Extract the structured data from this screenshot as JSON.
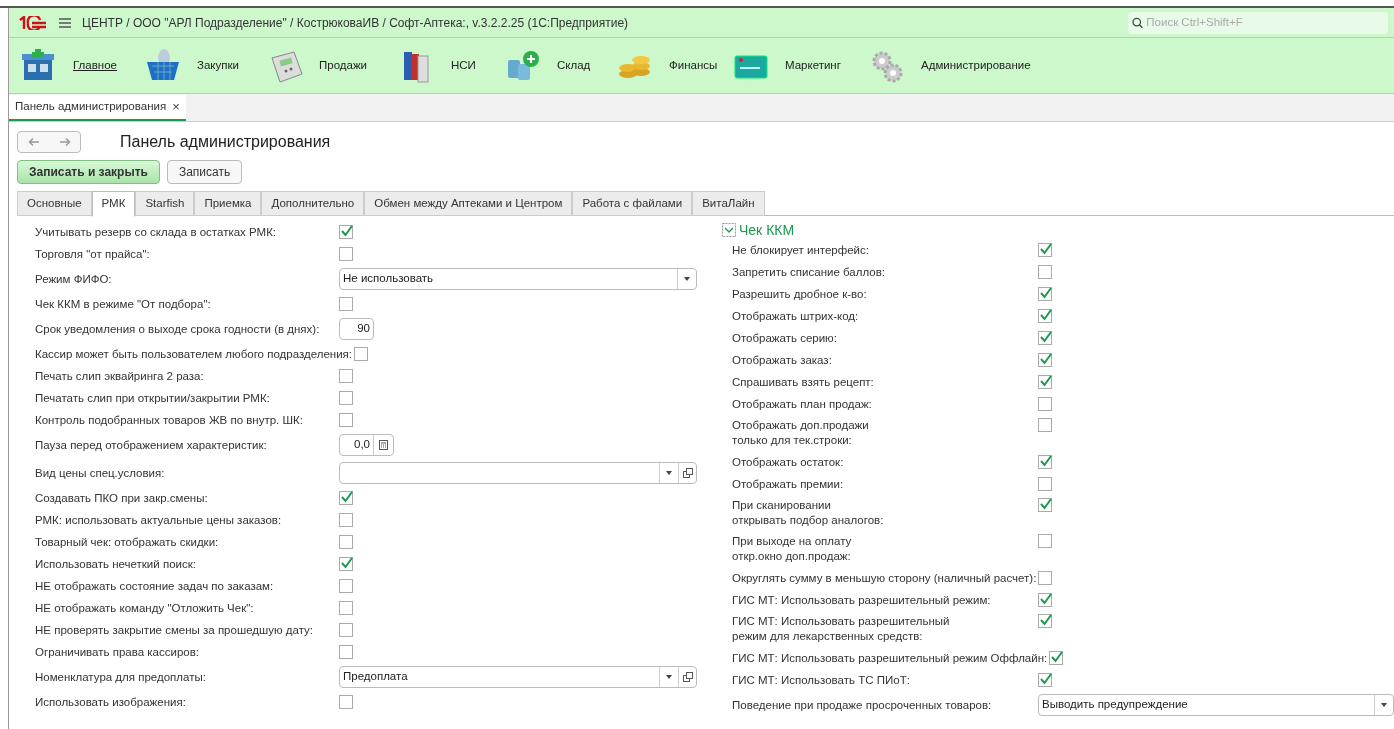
{
  "window": {
    "title": "ЦЕНТР / ООО \"АРЛ Подразделение\" / КострюковаИВ / Софт-Аптека:, v.3.2.2.25  (1С:Предприятие)",
    "search": {
      "placeholder": "Поиск Ctrl+Shift+F"
    }
  },
  "sections": [
    {
      "label": "Главное",
      "kind": "pharmacy",
      "selected": true
    },
    {
      "label": "Закупки",
      "kind": "basket",
      "selected": false
    },
    {
      "label": "Продажи",
      "kind": "terminal",
      "selected": false
    },
    {
      "label": "НСИ",
      "kind": "books",
      "selected": false
    },
    {
      "label": "Склад",
      "kind": "pills",
      "selected": false
    },
    {
      "label": "Финансы",
      "kind": "coins",
      "selected": false
    },
    {
      "label": "Маркетинг",
      "kind": "card",
      "selected": false
    },
    {
      "label": "Администрирование",
      "kind": "gears",
      "selected": false
    }
  ],
  "open_tabs": [
    {
      "label": "Панель администрирования",
      "close": "×",
      "selected": true
    }
  ],
  "form": {
    "title": "Панель администрирования",
    "buttons": [
      {
        "label": "Записать и закрыть",
        "kind": "primary"
      },
      {
        "label": "Записать",
        "kind": "plain"
      }
    ],
    "tabs": [
      {
        "label": "Основные",
        "selected": false
      },
      {
        "label": "РМК",
        "selected": true
      },
      {
        "label": "Starfish",
        "selected": false
      },
      {
        "label": "Приемка",
        "selected": false
      },
      {
        "label": "Дополнительно",
        "selected": false
      },
      {
        "label": "Обмен между Аптеками и Центром",
        "selected": false
      },
      {
        "label": "Работа с файлами",
        "selected": false
      },
      {
        "label": "ВитаЛайн",
        "selected": false
      }
    ],
    "left": [
      {
        "kind": "checkbox",
        "label": "Учитывать резерв со склада в остатках РМК:",
        "checked": true
      },
      {
        "kind": "checkbox",
        "label": "Торговля \"от прайса\":",
        "checked": false
      },
      {
        "kind": "select",
        "label": "Режим ФИФО:",
        "value": "Не использовать"
      },
      {
        "kind": "checkbox",
        "label": "Чек ККМ в режиме \"От подбора\":",
        "checked": false
      },
      {
        "kind": "number",
        "label": "Срок уведомления о выходе срока годности (в днях):",
        "value": "90"
      },
      {
        "kind": "checkbox",
        "label": "Кассир может быть пользователем любого подразделения:",
        "checked": false
      },
      {
        "kind": "checkbox",
        "label": "Печать слип эквайринга 2 раза:",
        "checked": false
      },
      {
        "kind": "checkbox",
        "label": "Печатать слип при открытии/закрытии РМК:",
        "checked": false
      },
      {
        "kind": "checkbox",
        "label": "Контроль подобранных товаров ЖВ по внутр. ШК:",
        "checked": false
      },
      {
        "kind": "calc",
        "label": "Пауза перед отображением характеристик:",
        "value": "0,0"
      },
      {
        "kind": "ref",
        "label": "Вид цены спец.условия:"
      },
      {
        "kind": "checkbox",
        "label": "Создавать ПКО при закр.смены:",
        "checked": true
      },
      {
        "kind": "checkbox",
        "label": "РМК: использовать актуальные цены заказов:",
        "checked": false
      },
      {
        "kind": "checkbox",
        "label": "Товарный чек: отображать скидки:",
        "checked": false
      },
      {
        "kind": "checkbox",
        "label": "Использовать нечеткий поиск:",
        "checked": true
      },
      {
        "kind": "checkbox",
        "label": "НЕ отображать состояние задач по заказам:",
        "checked": false
      },
      {
        "kind": "checkbox",
        "label": "НЕ отображать команду \"Отложить Чек\":",
        "checked": false
      },
      {
        "kind": "checkbox",
        "label": "НЕ проверять закрытие смены за прошедшую дату:",
        "checked": false
      },
      {
        "kind": "checkbox",
        "label": "Ограничивать права кассиров:",
        "checked": false
      },
      {
        "kind": "ref",
        "label": "Номенклатура для предоплаты:",
        "value": "Предоплата"
      },
      {
        "kind": "checkbox",
        "label": "Использовать изображения:",
        "checked": false
      }
    ],
    "group": {
      "title": "Чек ККМ",
      "expanded": true,
      "items": [
        {
          "kind": "checkbox",
          "label": "Не блокирует интерфейс:",
          "checked": true
        },
        {
          "kind": "checkbox",
          "label": "Запретить списание баллов:",
          "checked": false
        },
        {
          "kind": "checkbox",
          "label": "Разрешить дробное к-во:",
          "checked": true
        },
        {
          "kind": "checkbox",
          "label": "Отображать штрих-код:",
          "checked": true
        },
        {
          "kind": "checkbox",
          "label": "Отображать серию:",
          "checked": true
        },
        {
          "kind": "checkbox",
          "label": "Отображать заказ:",
          "checked": true
        },
        {
          "kind": "checkbox",
          "label": "Спрашивать взять рецепт:",
          "checked": true
        },
        {
          "kind": "checkbox",
          "label": "Отображать план продаж:",
          "checked": false
        },
        {
          "kind": "checkbox",
          "label": "Отображать доп.продажи\nтолько для тек.строки:",
          "checked": false
        },
        {
          "kind": "checkbox",
          "label": "Отображать остаток:",
          "checked": true
        },
        {
          "kind": "checkbox",
          "label": "Отображать премии:",
          "checked": false
        },
        {
          "kind": "checkbox",
          "label": "При сканировании\nоткрывать подбор аналогов:",
          "checked": true
        },
        {
          "kind": "checkbox",
          "label": "При выходе на оплату\nоткр.окно доп.продаж:",
          "checked": false
        },
        {
          "kind": "checkbox",
          "label": "Округлять сумму в меньшую сторону (наличный расчет):",
          "checked": false
        },
        {
          "kind": "checkbox",
          "label": "ГИС МТ: Использовать разрешительный режим:",
          "checked": true
        },
        {
          "kind": "checkbox",
          "label": "ГИС МТ: Использовать разрешительный\nрежим для лекарственных средств:",
          "checked": true
        },
        {
          "kind": "checkbox",
          "label": "ГИС МТ: Использовать разрешительный режим Оффлайн:",
          "checked": true
        },
        {
          "kind": "checkbox",
          "label": "ГИС МТ: Использовать ТС ПИоТ:",
          "checked": true
        },
        {
          "kind": "select",
          "label": "Поведение при продаже просроченных товаров:",
          "value": "Выводить предупреждение"
        }
      ]
    }
  }
}
